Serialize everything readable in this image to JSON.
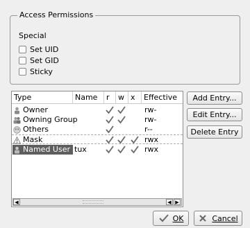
{
  "access_permissions": {
    "title": "Access Permissions",
    "special_label": "Special",
    "checkboxes": [
      {
        "label": "Set UID",
        "checked": false
      },
      {
        "label": "Set GID",
        "checked": false
      },
      {
        "label": "Sticky",
        "checked": false
      }
    ]
  },
  "acl_table": {
    "headers": [
      "Type",
      "Name",
      "r",
      "w",
      "x",
      "Effective"
    ],
    "rows": [
      {
        "type": "Owner",
        "name": "",
        "r": true,
        "w": true,
        "x": false,
        "effective": "rw-",
        "icon": "user-icon"
      },
      {
        "type": "Owning Group",
        "name": "",
        "r": true,
        "w": true,
        "x": false,
        "effective": "rw-",
        "icon": "group-icon"
      },
      {
        "type": "Others",
        "name": "",
        "r": true,
        "w": false,
        "x": false,
        "effective": "r--",
        "icon": "others-icon"
      },
      {
        "type": "Mask",
        "name": "",
        "r": true,
        "w": true,
        "x": true,
        "effective": "rwx",
        "icon": "warning-icon"
      },
      {
        "type": "Named User",
        "name": "tux",
        "r": true,
        "w": true,
        "x": true,
        "effective": "rwx",
        "icon": "user-icon",
        "selected": true
      }
    ]
  },
  "side_buttons": {
    "add": "Add Entry...",
    "edit": "Edit Entry...",
    "delete": "Delete Entry"
  },
  "dialog_buttons": {
    "ok": "OK",
    "cancel": "Cancel"
  },
  "colors": {
    "check": "#6a6a6a",
    "selection": "#5e5e5e"
  }
}
